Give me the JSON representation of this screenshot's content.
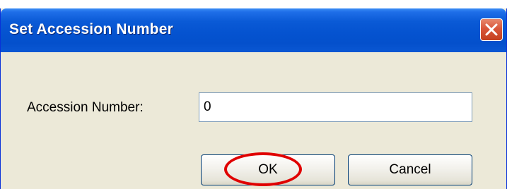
{
  "window": {
    "title": "Set Accession Number",
    "close_icon": "close-x-icon"
  },
  "form": {
    "accession_label": "Accession Number:",
    "accession_value": "0"
  },
  "buttons": {
    "ok_label": "OK",
    "cancel_label": "Cancel"
  },
  "annotation": {
    "highlight_color": "#e00000",
    "highlight_target": "OK"
  },
  "colors": {
    "titlebar": "#0553d0",
    "dialog_background": "#ECE9D8",
    "close_button": "#d9563a"
  }
}
